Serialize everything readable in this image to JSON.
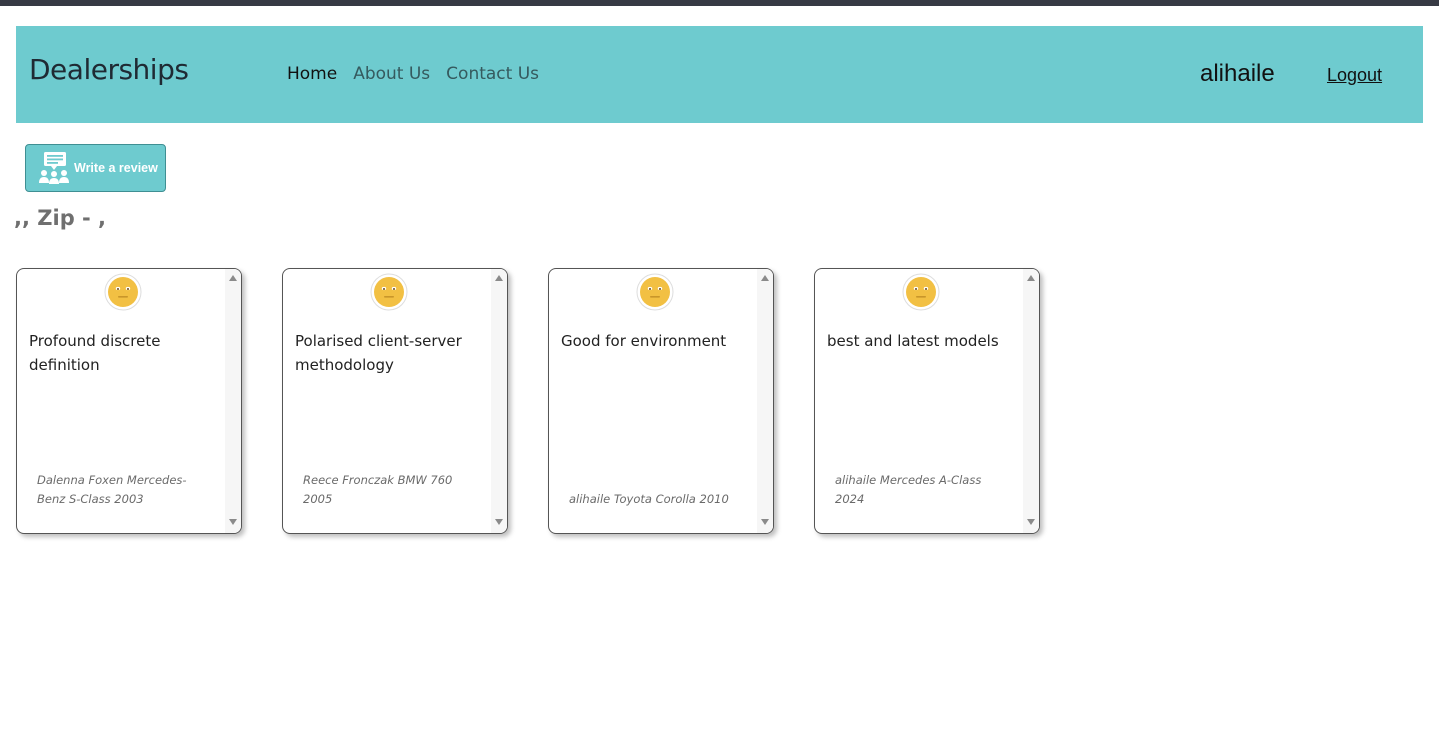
{
  "navbar": {
    "brand": "Dealerships",
    "links": [
      {
        "label": "Home"
      },
      {
        "label": "About Us"
      },
      {
        "label": "Contact Us"
      }
    ],
    "username": "alihaile",
    "logout_label": "Logout"
  },
  "review_button": {
    "label": "Write a review",
    "icon": "people-chat-icon"
  },
  "dealer": {
    "address_line": ",, Zip - ,"
  },
  "reviews": [
    {
      "text": "Profound discrete definition",
      "reviewer": "Dalenna Foxen Mercedes-Benz S-Class 2003",
      "sentiment_icon": "neutral-face-icon"
    },
    {
      "text": "Polarised client-server methodology",
      "reviewer": "Reece Fronczak BMW 760 2005",
      "sentiment_icon": "neutral-face-icon"
    },
    {
      "text": "Good for environment",
      "reviewer": "alihaile Toyota Corolla 2010",
      "sentiment_icon": "neutral-face-icon"
    },
    {
      "text": "best and latest models",
      "reviewer": "alihaile Mercedes A-Class 2024",
      "sentiment_icon": "neutral-face-icon"
    }
  ],
  "colors": {
    "navbar_bg": "#6ecbcf",
    "top_strip": "#373a44",
    "face_yellow": "#f2c043"
  }
}
